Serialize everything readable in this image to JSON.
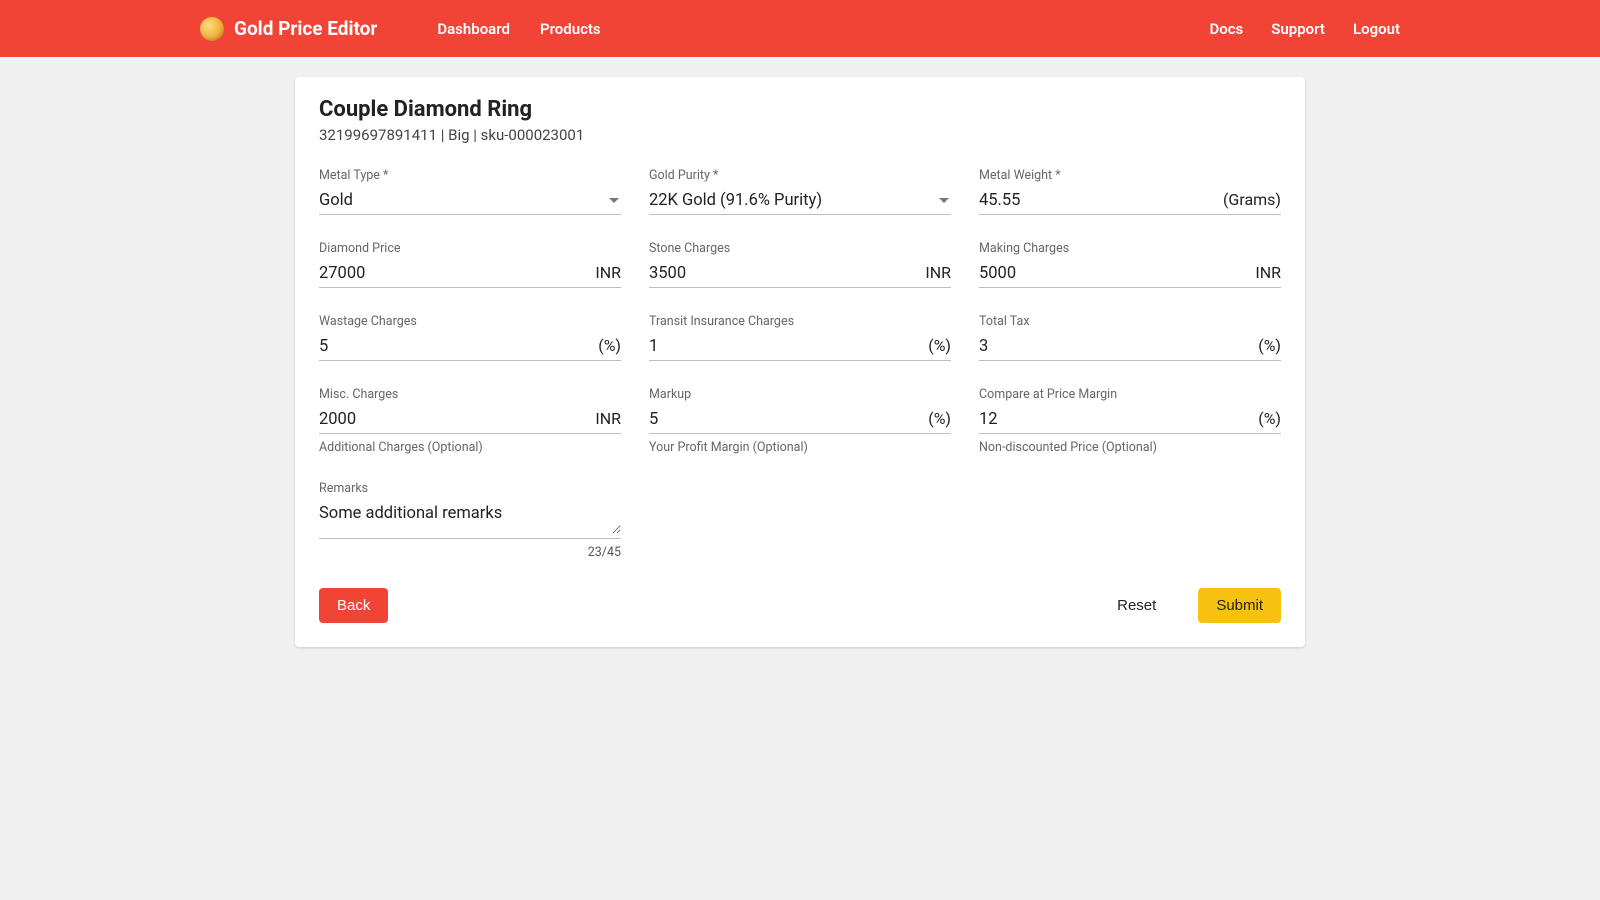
{
  "header": {
    "app_name": "Gold Price Editor",
    "nav_left": {
      "dashboard": "Dashboard",
      "products": "Products"
    },
    "nav_right": {
      "docs": "Docs",
      "support": "Support",
      "logout": "Logout"
    }
  },
  "page": {
    "title": "Couple Diamond Ring",
    "subtitle": "32199697891411 | Big | sku-000023001"
  },
  "fields": {
    "metal_type": {
      "label": "Metal Type *",
      "value": "Gold"
    },
    "gold_purity": {
      "label": "Gold Purity *",
      "value": "22K Gold (91.6% Purity)"
    },
    "metal_weight": {
      "label": "Metal Weight *",
      "value": "45.55",
      "suffix": "(Grams)"
    },
    "diamond_price": {
      "label": "Diamond Price",
      "value": "27000",
      "suffix": "INR"
    },
    "stone_charges": {
      "label": "Stone Charges",
      "value": "3500",
      "suffix": "INR"
    },
    "making_charges": {
      "label": "Making Charges",
      "value": "5000",
      "suffix": "INR"
    },
    "wastage_charges": {
      "label": "Wastage Charges",
      "value": "5",
      "suffix": "(%)"
    },
    "transit_insurance": {
      "label": "Transit Insurance Charges",
      "value": "1",
      "suffix": "(%)"
    },
    "total_tax": {
      "label": "Total Tax",
      "value": "3",
      "suffix": "(%)"
    },
    "misc_charges": {
      "label": "Misc. Charges",
      "value": "2000",
      "suffix": "INR",
      "helper": "Additional Charges (Optional)"
    },
    "markup": {
      "label": "Markup",
      "value": "5",
      "suffix": "(%)",
      "helper": "Your Profit Margin (Optional)"
    },
    "compare_margin": {
      "label": "Compare at Price Margin",
      "value": "12",
      "suffix": "(%)",
      "helper": "Non-discounted Price (Optional)"
    },
    "remarks": {
      "label": "Remarks",
      "value": "Some additional remarks",
      "counter": "23/45"
    }
  },
  "actions": {
    "back": "Back",
    "reset": "Reset",
    "submit": "Submit"
  }
}
